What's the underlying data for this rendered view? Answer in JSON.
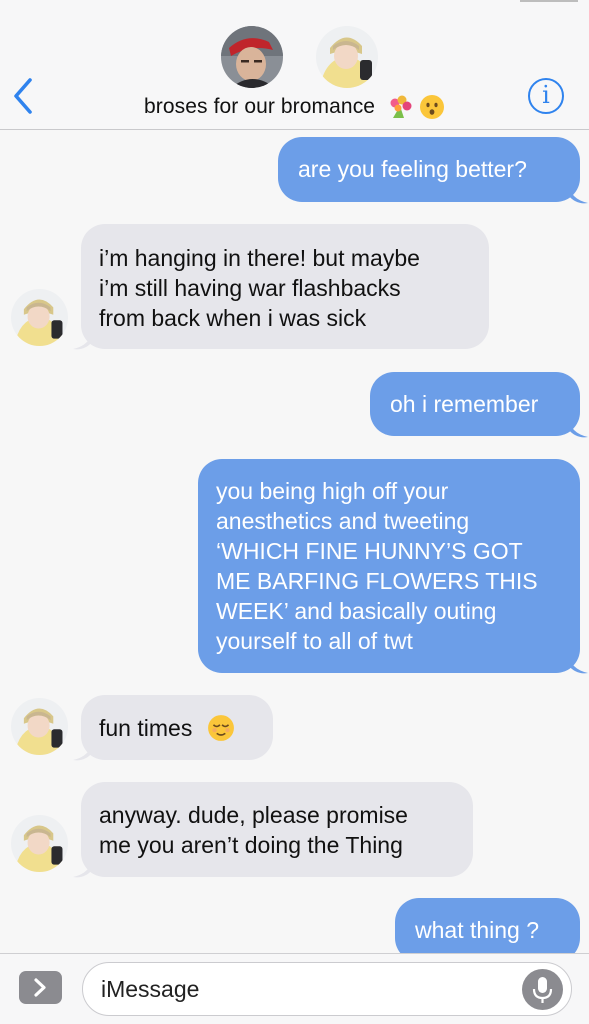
{
  "header": {
    "group_title": "broses for our bromance",
    "title_emojis": [
      "bouquet-emoji",
      "hushed-face-emoji"
    ],
    "info_label": "i",
    "avatars": [
      "avatar-red-cap",
      "avatar-yellow-hoodie"
    ]
  },
  "messages": [
    {
      "direction": "outgoing",
      "lines": [
        "are you feeling better?"
      ]
    },
    {
      "direction": "incoming",
      "lines": [
        "i’m hanging in there! but maybe",
        "i’m still having war flashbacks",
        "from back when i was sick"
      ]
    },
    {
      "direction": "outgoing",
      "lines": [
        "oh i remember"
      ]
    },
    {
      "direction": "outgoing",
      "lines": [
        "you being high off your",
        "anesthetics and tweeting",
        "‘WHICH FINE HUNNY’S GOT",
        "ME BARFING FLOWERS THIS",
        "WEEK’ and basically outing",
        "yourself to all of twt"
      ]
    },
    {
      "direction": "incoming",
      "lines": [
        "fun times"
      ],
      "emoji": "relieved-face-emoji"
    },
    {
      "direction": "incoming",
      "lines": [
        "anyway. dude, please promise",
        "me you aren’t doing the Thing"
      ]
    },
    {
      "direction": "outgoing",
      "lines": [
        "what thing ?"
      ]
    }
  ],
  "composer": {
    "placeholder": "iMessage"
  },
  "colors": {
    "outgoing_bubble": "#6c9ee8",
    "incoming_bubble": "#e6e6eb",
    "accent": "#2f83ee"
  }
}
